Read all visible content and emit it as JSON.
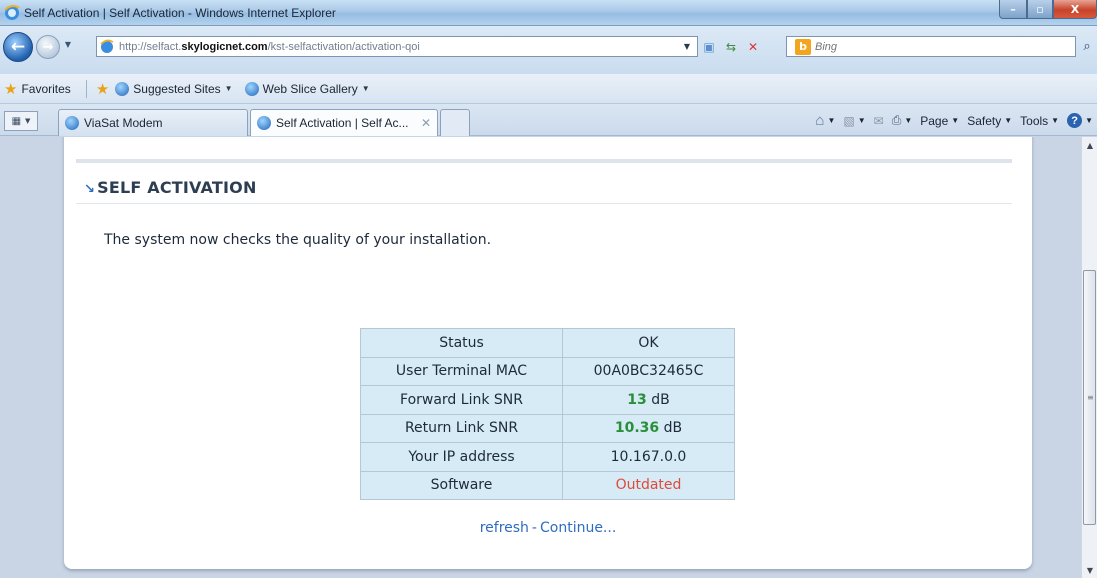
{
  "window": {
    "title": "Self Activation | Self Activation - Windows Internet Explorer",
    "minimize_glyph": "–",
    "maximize_glyph": "▫",
    "close_glyph": "X"
  },
  "address_bar": {
    "url_prefix": "http://selfact.",
    "url_domain": "skylogicnet.com",
    "url_path": "/kst-selfactivation/activation-qoi"
  },
  "search": {
    "placeholder": "Bing"
  },
  "favorites_bar": {
    "favorites_label": "Favorites",
    "items": [
      {
        "label": "Suggested Sites"
      },
      {
        "label": "Web Slice Gallery"
      }
    ]
  },
  "tabs": [
    {
      "label": "ViaSat Modem"
    },
    {
      "label": "Self Activation | Self Ac..."
    }
  ],
  "command_bar": {
    "page_label": "Page",
    "safety_label": "Safety",
    "tools_label": "Tools"
  },
  "content": {
    "heading": "SELF ACTIVATION",
    "intro": "The system now checks the quality of your installation.",
    "table": {
      "status_label": "Status",
      "status_value": "OK",
      "mac_label": "User Terminal MAC",
      "mac_value": "00A0BC32465C",
      "fwd_label": "Forward Link SNR",
      "fwd_value": "13",
      "fwd_unit": "dB",
      "ret_label": "Return Link SNR",
      "ret_value": "10.36",
      "ret_unit": "dB",
      "ip_label": "Your IP address",
      "ip_value": "10.167.0.0",
      "software_label": "Software",
      "software_value": "Outdated"
    },
    "refresh_link": "refresh",
    "separator": "-",
    "continue_link": "Continue..."
  },
  "colors": {
    "good": "#2a8f3a",
    "bad": "#e04a3a",
    "link": "#2f6cc0",
    "table_bg": "#d6ebf5"
  }
}
